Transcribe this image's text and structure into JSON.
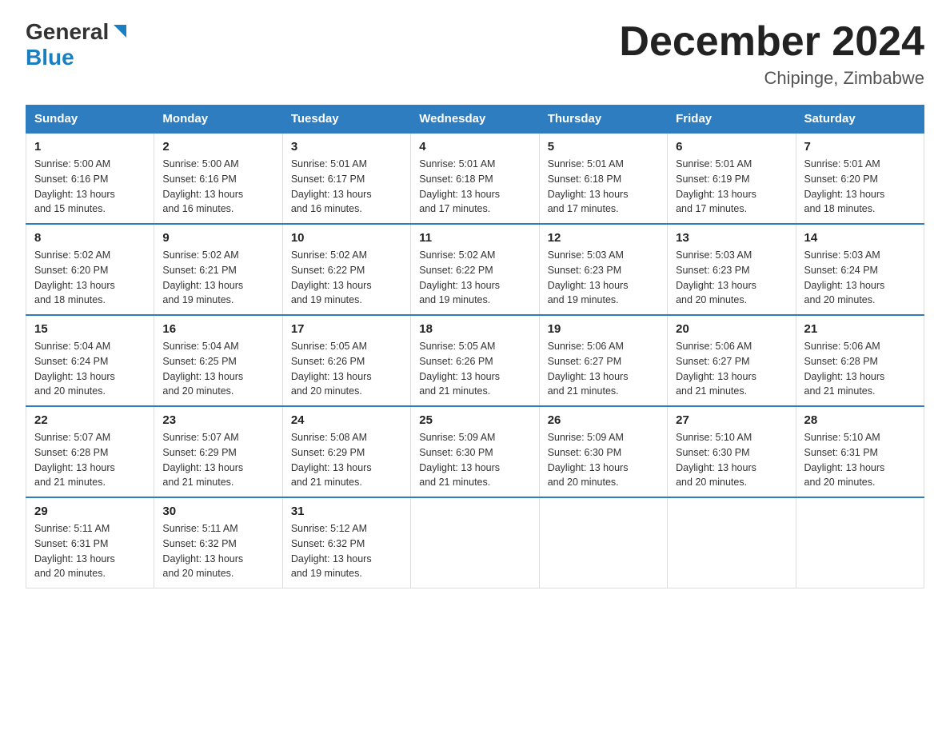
{
  "header": {
    "logo_general": "General",
    "logo_blue": "Blue",
    "month_title": "December 2024",
    "location": "Chipinge, Zimbabwe"
  },
  "days_of_week": [
    "Sunday",
    "Monday",
    "Tuesday",
    "Wednesday",
    "Thursday",
    "Friday",
    "Saturday"
  ],
  "weeks": [
    [
      {
        "day": "1",
        "sunrise": "5:00 AM",
        "sunset": "6:16 PM",
        "daylight": "13 hours and 15 minutes."
      },
      {
        "day": "2",
        "sunrise": "5:00 AM",
        "sunset": "6:16 PM",
        "daylight": "13 hours and 16 minutes."
      },
      {
        "day": "3",
        "sunrise": "5:01 AM",
        "sunset": "6:17 PM",
        "daylight": "13 hours and 16 minutes."
      },
      {
        "day": "4",
        "sunrise": "5:01 AM",
        "sunset": "6:18 PM",
        "daylight": "13 hours and 17 minutes."
      },
      {
        "day": "5",
        "sunrise": "5:01 AM",
        "sunset": "6:18 PM",
        "daylight": "13 hours and 17 minutes."
      },
      {
        "day": "6",
        "sunrise": "5:01 AM",
        "sunset": "6:19 PM",
        "daylight": "13 hours and 17 minutes."
      },
      {
        "day": "7",
        "sunrise": "5:01 AM",
        "sunset": "6:20 PM",
        "daylight": "13 hours and 18 minutes."
      }
    ],
    [
      {
        "day": "8",
        "sunrise": "5:02 AM",
        "sunset": "6:20 PM",
        "daylight": "13 hours and 18 minutes."
      },
      {
        "day": "9",
        "sunrise": "5:02 AM",
        "sunset": "6:21 PM",
        "daylight": "13 hours and 19 minutes."
      },
      {
        "day": "10",
        "sunrise": "5:02 AM",
        "sunset": "6:22 PM",
        "daylight": "13 hours and 19 minutes."
      },
      {
        "day": "11",
        "sunrise": "5:02 AM",
        "sunset": "6:22 PM",
        "daylight": "13 hours and 19 minutes."
      },
      {
        "day": "12",
        "sunrise": "5:03 AM",
        "sunset": "6:23 PM",
        "daylight": "13 hours and 19 minutes."
      },
      {
        "day": "13",
        "sunrise": "5:03 AM",
        "sunset": "6:23 PM",
        "daylight": "13 hours and 20 minutes."
      },
      {
        "day": "14",
        "sunrise": "5:03 AM",
        "sunset": "6:24 PM",
        "daylight": "13 hours and 20 minutes."
      }
    ],
    [
      {
        "day": "15",
        "sunrise": "5:04 AM",
        "sunset": "6:24 PM",
        "daylight": "13 hours and 20 minutes."
      },
      {
        "day": "16",
        "sunrise": "5:04 AM",
        "sunset": "6:25 PM",
        "daylight": "13 hours and 20 minutes."
      },
      {
        "day": "17",
        "sunrise": "5:05 AM",
        "sunset": "6:26 PM",
        "daylight": "13 hours and 20 minutes."
      },
      {
        "day": "18",
        "sunrise": "5:05 AM",
        "sunset": "6:26 PM",
        "daylight": "13 hours and 21 minutes."
      },
      {
        "day": "19",
        "sunrise": "5:06 AM",
        "sunset": "6:27 PM",
        "daylight": "13 hours and 21 minutes."
      },
      {
        "day": "20",
        "sunrise": "5:06 AM",
        "sunset": "6:27 PM",
        "daylight": "13 hours and 21 minutes."
      },
      {
        "day": "21",
        "sunrise": "5:06 AM",
        "sunset": "6:28 PM",
        "daylight": "13 hours and 21 minutes."
      }
    ],
    [
      {
        "day": "22",
        "sunrise": "5:07 AM",
        "sunset": "6:28 PM",
        "daylight": "13 hours and 21 minutes."
      },
      {
        "day": "23",
        "sunrise": "5:07 AM",
        "sunset": "6:29 PM",
        "daylight": "13 hours and 21 minutes."
      },
      {
        "day": "24",
        "sunrise": "5:08 AM",
        "sunset": "6:29 PM",
        "daylight": "13 hours and 21 minutes."
      },
      {
        "day": "25",
        "sunrise": "5:09 AM",
        "sunset": "6:30 PM",
        "daylight": "13 hours and 21 minutes."
      },
      {
        "day": "26",
        "sunrise": "5:09 AM",
        "sunset": "6:30 PM",
        "daylight": "13 hours and 20 minutes."
      },
      {
        "day": "27",
        "sunrise": "5:10 AM",
        "sunset": "6:30 PM",
        "daylight": "13 hours and 20 minutes."
      },
      {
        "day": "28",
        "sunrise": "5:10 AM",
        "sunset": "6:31 PM",
        "daylight": "13 hours and 20 minutes."
      }
    ],
    [
      {
        "day": "29",
        "sunrise": "5:11 AM",
        "sunset": "6:31 PM",
        "daylight": "13 hours and 20 minutes."
      },
      {
        "day": "30",
        "sunrise": "5:11 AM",
        "sunset": "6:32 PM",
        "daylight": "13 hours and 20 minutes."
      },
      {
        "day": "31",
        "sunrise": "5:12 AM",
        "sunset": "6:32 PM",
        "daylight": "13 hours and 19 minutes."
      },
      null,
      null,
      null,
      null
    ]
  ],
  "labels": {
    "sunrise": "Sunrise:",
    "sunset": "Sunset:",
    "daylight": "Daylight:"
  }
}
